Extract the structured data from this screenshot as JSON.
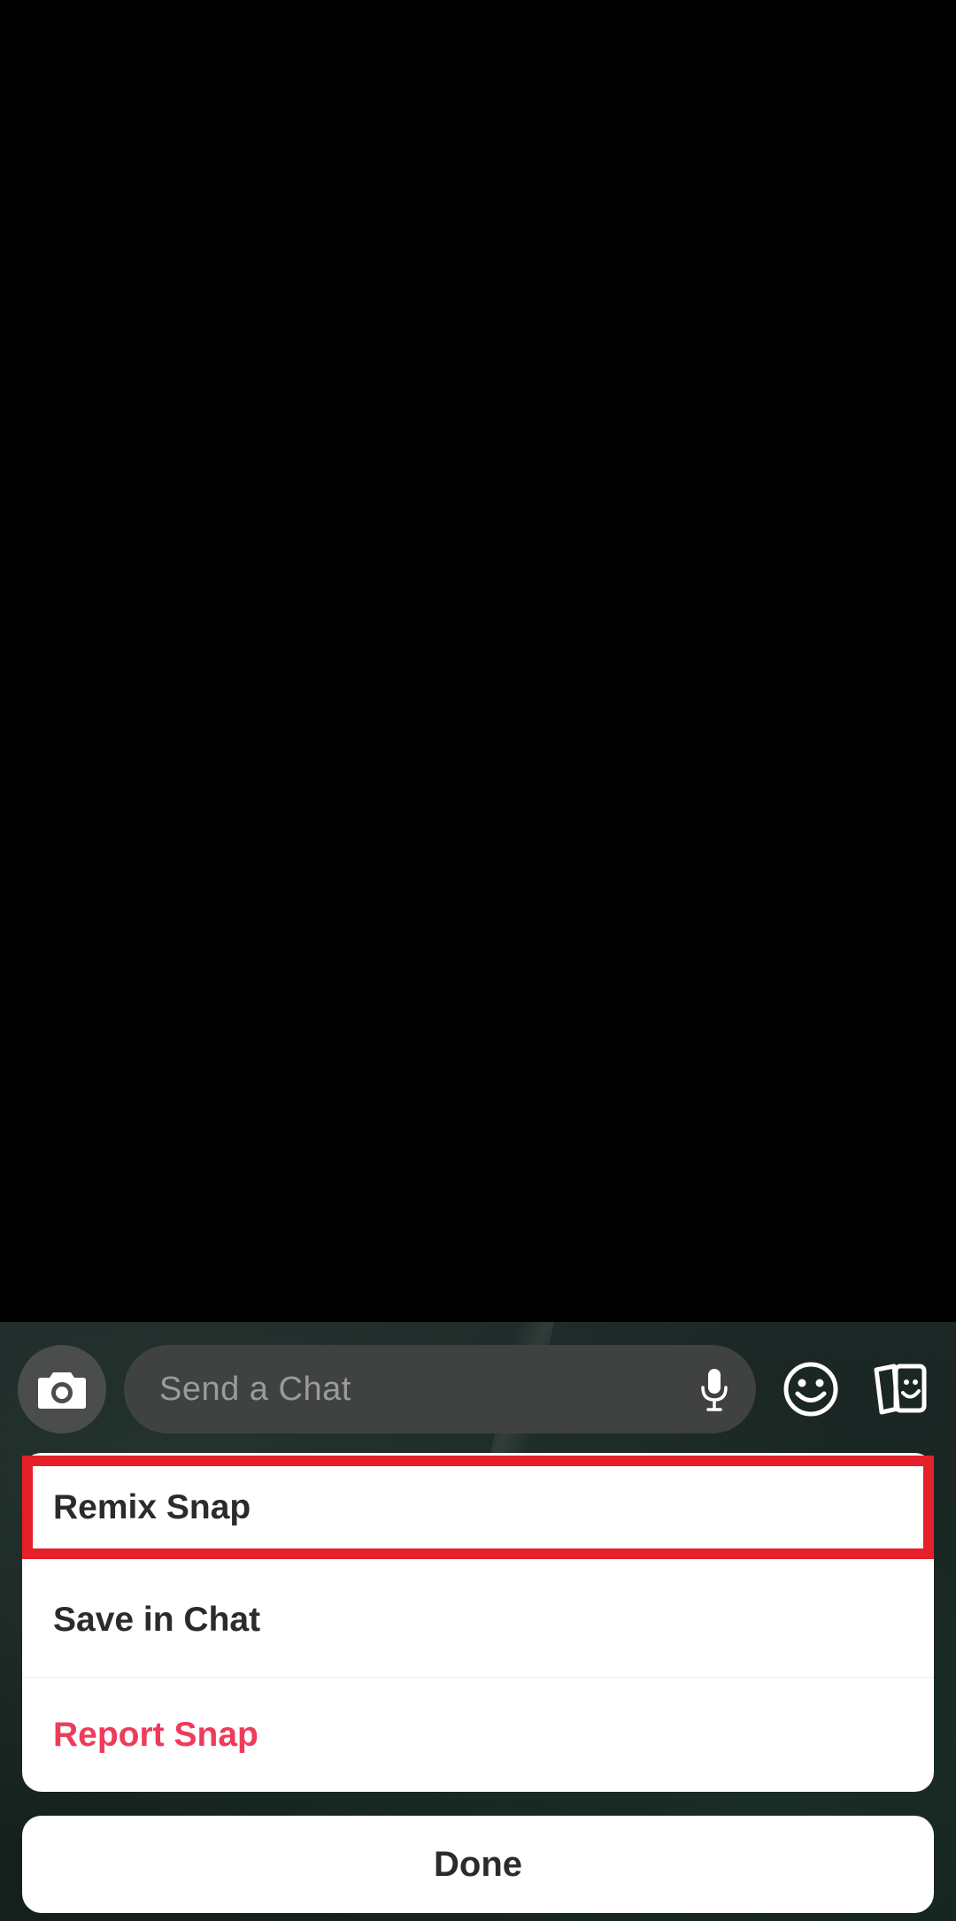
{
  "chat_bar": {
    "camera_icon": "camera-icon",
    "input_placeholder": "Send a Chat",
    "mic_icon": "microphone-icon",
    "emoji_icon": "smiley-icon",
    "cards_icon": "cards-icon"
  },
  "action_sheet": {
    "items": [
      {
        "label": "Remix Snap",
        "highlighted": true
      },
      {
        "label": "Save in Chat"
      },
      {
        "label": "Report Snap",
        "color": "#ee3b5a"
      }
    ]
  },
  "done_label": "Done",
  "colors": {
    "highlight": "#e5202a",
    "destructive": "#ee3b5a",
    "sheet_bg": "#ffffff"
  }
}
